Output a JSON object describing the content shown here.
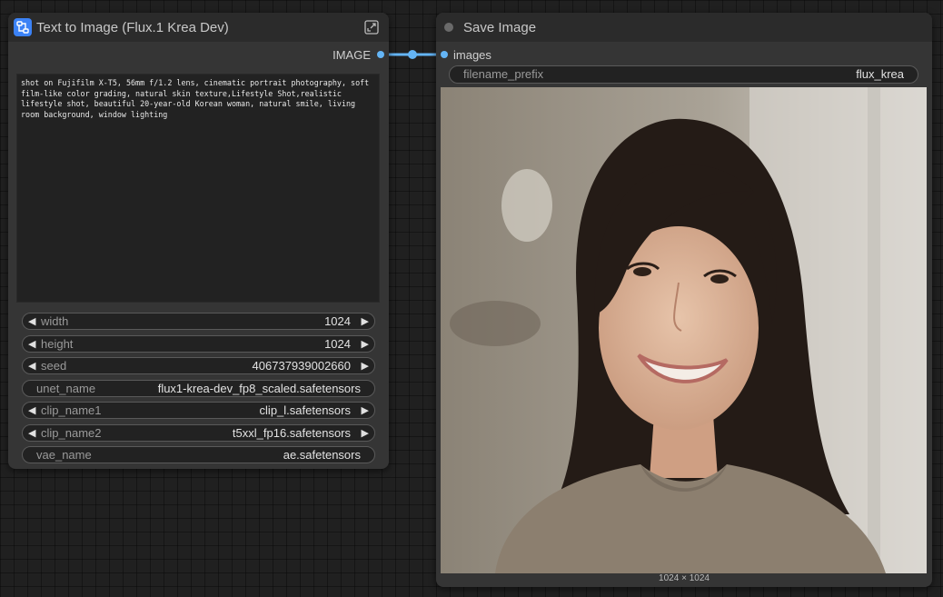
{
  "node_text_to_image": {
    "title": "Text to Image (Flux.1 Krea Dev)",
    "output_label": "IMAGE",
    "prompt": "shot on Fujifilm X-T5, 56mm f/1.2 lens, cinematic portrait photography, soft film-like color grading, natural skin texture,Lifestyle Shot,realistic lifestyle shot, beautiful 20-year-old Korean woman, natural smile, living room background, window lighting",
    "widgets": {
      "width": {
        "label": "width",
        "value": "1024"
      },
      "height": {
        "label": "height",
        "value": "1024"
      },
      "seed": {
        "label": "seed",
        "value": "406737939002660"
      },
      "unet_name": {
        "label": "unet_name",
        "value": "flux1-krea-dev_fp8_scaled.safetensors"
      },
      "clip_name1": {
        "label": "clip_name1",
        "value": "clip_l.safetensors"
      },
      "clip_name2": {
        "label": "clip_name2",
        "value": "t5xxl_fp16.safetensors"
      },
      "vae_name": {
        "label": "vae_name",
        "value": "ae.safetensors"
      }
    }
  },
  "node_save_image": {
    "title": "Save Image",
    "input_label": "images",
    "filename_prefix": {
      "label": "filename_prefix",
      "value": "flux_krea"
    },
    "image_size": "1024 × 1024"
  },
  "colors": {
    "link": "#64b5f6",
    "node_bg": "#353535",
    "header_bg": "#2b2b2b",
    "subgraph_icon": "#3b82f6"
  },
  "icons": [
    "subgraph-icon",
    "expand-icon",
    "status-dot-icon"
  ]
}
